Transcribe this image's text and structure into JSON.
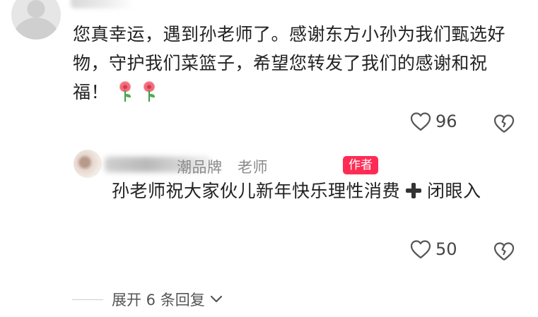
{
  "comment": {
    "text": "您真幸运，遇到孙老师了。感谢东方小孙为我们甄选好物，守护我们菜篮子，希望您转发了我们的感谢和祝福！",
    "emojis": [
      "rose-icon",
      "rose-icon"
    ],
    "like_count": "96"
  },
  "reply": {
    "author_name_visible": "潮品牌",
    "author_name_tail": "老师",
    "badge": "作者",
    "text_part1": "孙老师祝大家伙儿新年快乐理性消费",
    "text_part2": "闭眼入",
    "like_count": "50"
  },
  "expand": {
    "label": "展开 6 条回复"
  },
  "colors": {
    "badge_bg": "#fe2c55",
    "text": "#222222",
    "muted": "#555555"
  }
}
